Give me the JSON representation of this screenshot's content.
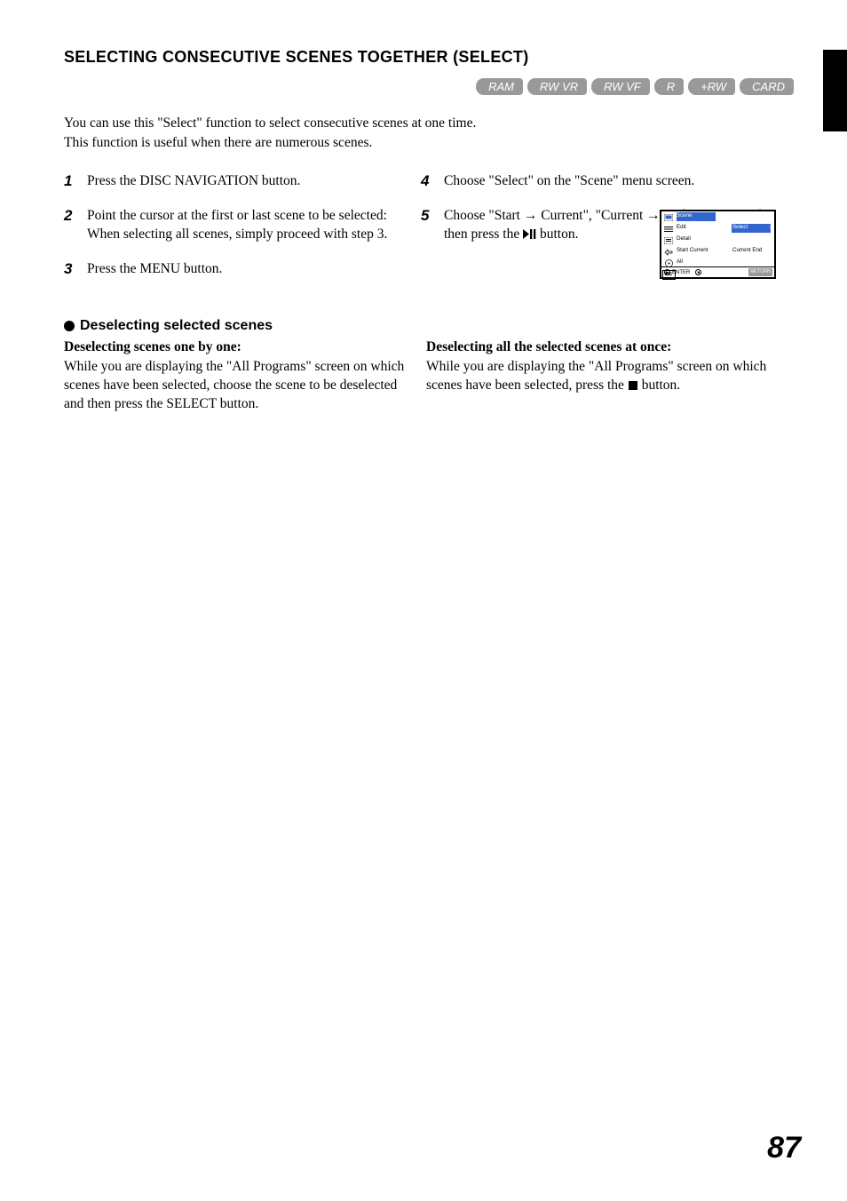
{
  "page_number": "87",
  "format_pills": [
    "RAM",
    "RW VR",
    "RW VF",
    "R",
    "+RW",
    "CARD"
  ],
  "section_title": "SELECTING CONSECUTIVE SCENES TOGETHER (SELECT)",
  "intro": {
    "line1": "You can use this \"Select\" function to select consecutive scenes at one time.",
    "line2": "This function is useful when there are numerous scenes."
  },
  "steps": {
    "s1": {
      "num": "1",
      "text": "Press the DISC NAVIGATION button."
    },
    "s2": {
      "num": "2",
      "text": "Point the cursor at the first or last scene to be selected: When selecting all scenes, simply proceed with step 3."
    },
    "s3": {
      "num": "3",
      "text": "Press the MENU button."
    },
    "s4": {
      "num": "4",
      "text": "Choose \"Select\" on the \"Scene\" menu screen."
    },
    "s5": {
      "num": "5",
      "text_pre": "Choose \"Start ",
      "arrow1": "→",
      "text_mid1": " Current\", \"Current ",
      "arrow2": "→",
      "text_mid2": " End\" or \"All\" and then press the ",
      "text_post": " button."
    }
  },
  "menu_fig": {
    "row0": "Scene",
    "row1_left": "Edit",
    "row1_right": "Select",
    "row2": "Detail",
    "row3_left": "Start  Current",
    "row3_right": "Current  End",
    "row4": "All",
    "etc": "etc",
    "footer_enter": "ENTER",
    "footer_return": "RETURN"
  },
  "deselect": {
    "title": "Deselecting selected scenes",
    "one_title": "Deselecting scenes one by one:",
    "one_body": "While you are displaying the \"All Programs\" screen on which scenes have been selected, choose the scene to be deselected and then press the SELECT button.",
    "all_title": "Deselecting all the selected scenes at once:",
    "all_body_pre": "While you are displaying the \"All Programs\" screen on which scenes have been selected, press the ",
    "all_body_post": " button."
  }
}
